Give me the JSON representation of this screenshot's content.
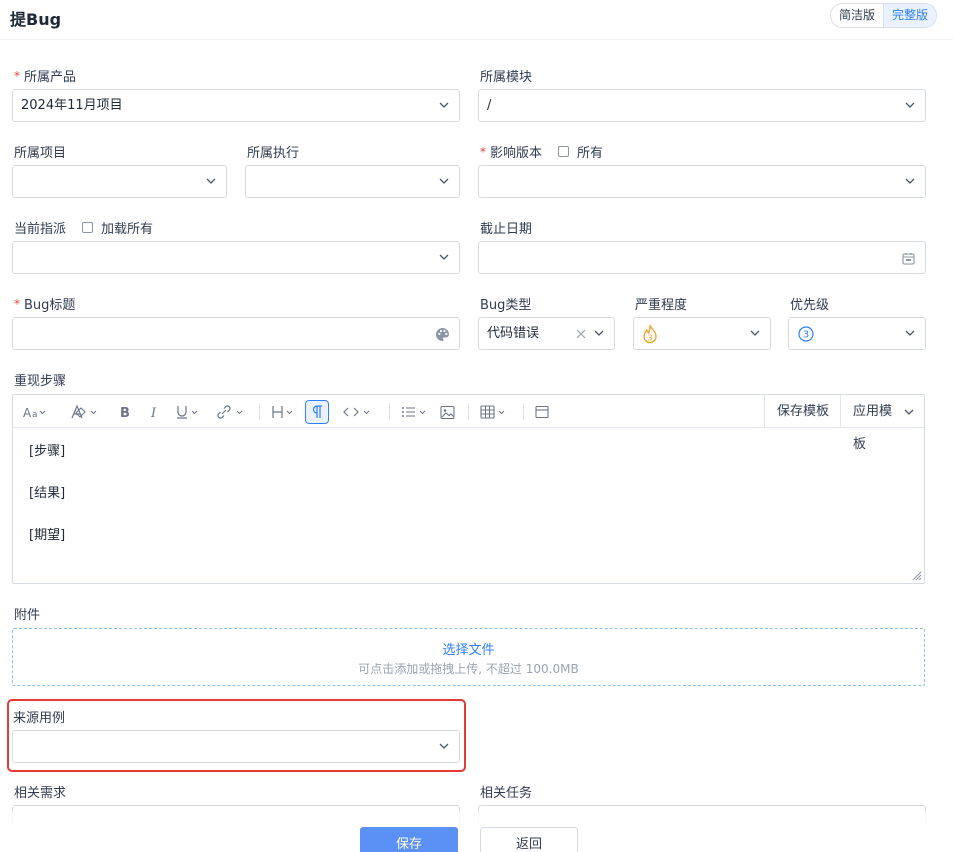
{
  "header": {
    "title": "提Bug",
    "modes": [
      "简洁版",
      "完整版"
    ],
    "active_mode": "完整版"
  },
  "form": {
    "product": {
      "label": "所属产品",
      "value": "2024年11月项目",
      "required": true
    },
    "module": {
      "label": "所属模块",
      "value": "/"
    },
    "project": {
      "label": "所属项目",
      "value": ""
    },
    "execution": {
      "label": "所属执行",
      "value": ""
    },
    "affected_build": {
      "label": "影响版本",
      "required": true,
      "all_label": "所有",
      "value": ""
    },
    "assigned_to": {
      "label": "当前指派",
      "load_all_label": "加载所有",
      "value": ""
    },
    "deadline": {
      "label": "截止日期",
      "value": ""
    },
    "bug_title": {
      "label": "Bug标题",
      "required": true,
      "value": ""
    },
    "bug_type": {
      "label": "Bug类型",
      "value": "代码错误"
    },
    "severity": {
      "label": "严重程度",
      "value": "3"
    },
    "priority": {
      "label": "优先级",
      "value": "3"
    },
    "steps": {
      "label": "重现步骤",
      "save_template": "保存模板",
      "apply_template": "应用模板",
      "content": [
        "[步骤]",
        "[结果]",
        "[期望]"
      ]
    },
    "attachment": {
      "label": "附件",
      "button": "选择文件",
      "hint": "可点击添加或拖拽上传, 不超过 100.0MB"
    },
    "source_case": {
      "label": "来源用例",
      "value": ""
    },
    "related_story": {
      "label": "相关需求"
    },
    "related_task": {
      "label": "相关任务"
    }
  },
  "footer": {
    "save": "保存",
    "back": "返回"
  },
  "colors": {
    "primary": "#2e7fff",
    "required": "#e8433e",
    "highlight": "#e53935",
    "severity": "#f0a020"
  }
}
